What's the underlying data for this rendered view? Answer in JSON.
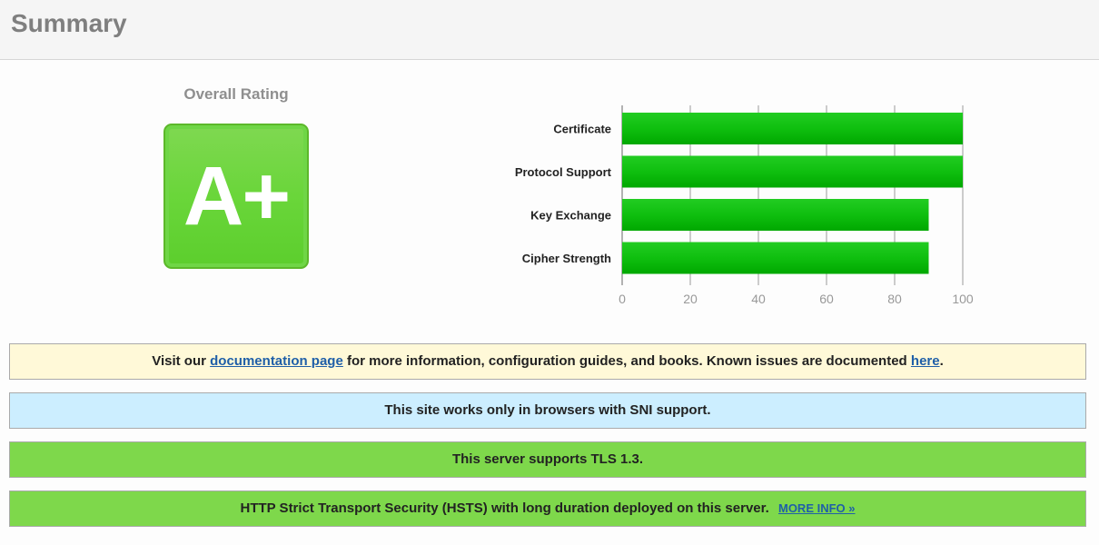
{
  "header": {
    "title": "Summary"
  },
  "rating": {
    "label": "Overall Rating",
    "grade": "A+",
    "color": "#6ad63a"
  },
  "chart_data": {
    "type": "bar",
    "orientation": "horizontal",
    "categories": [
      "Certificate",
      "Protocol Support",
      "Key Exchange",
      "Cipher Strength"
    ],
    "values": [
      100,
      100,
      90,
      90
    ],
    "xlim": [
      0,
      100
    ],
    "ticks": [
      "0",
      "20",
      "40",
      "60",
      "80",
      "100"
    ],
    "grid": true,
    "bar_color": "#0fbf0f"
  },
  "notices": {
    "docs": {
      "prefix": "Visit our ",
      "link1": "documentation page",
      "middle": " for more information, configuration guides, and books. Known issues are documented ",
      "link2": "here",
      "suffix": "."
    },
    "sni": {
      "text": "This site works only in browsers with SNI support."
    },
    "tls": {
      "text": "This server supports TLS 1.3."
    },
    "hsts": {
      "text": "HTTP Strict Transport Security (HSTS) with long duration deployed on this server.",
      "link": "MORE INFO »"
    }
  }
}
